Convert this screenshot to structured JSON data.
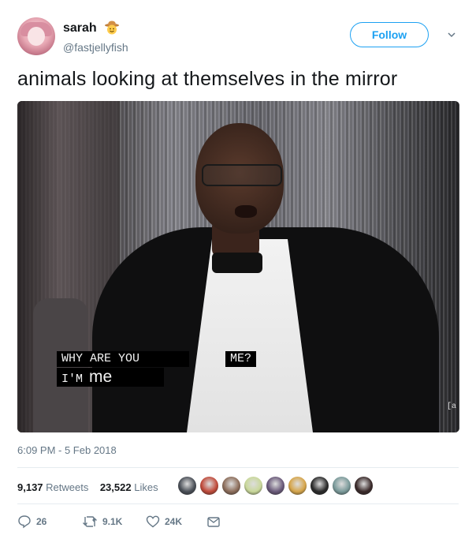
{
  "user": {
    "name": "sarah",
    "handle": "@fastjellyfish",
    "name_emoji": "cowboy-face-emoji",
    "follow_label": "Follow"
  },
  "tweet": {
    "text": "animals looking at themselves in the mirror",
    "timestamp": "6:09 PM - 5 Feb 2018"
  },
  "media": {
    "caption_line1": "WHY ARE YOU",
    "caption_line1_end": "ME?",
    "caption_line2_prefix": "I'M",
    "caption_line2_word": "me",
    "corner_mark": "[a"
  },
  "stats": {
    "retweets_count": "9,137",
    "retweets_label": "Retweets",
    "likes_count": "23,522",
    "likes_label": "Likes",
    "liker_colors": [
      "#4a4f57",
      "#c04a3a",
      "#8c6d5a",
      "#c9d89a",
      "#6a5a7a",
      "#d6a54a",
      "#2a2a2a",
      "#7a9a9a",
      "#3a2a2a"
    ]
  },
  "actions": {
    "replies": "26",
    "retweets": "9.1K",
    "likes": "24K"
  },
  "colors": {
    "accent": "#1da1f2",
    "secondary_text": "#657786",
    "divider": "#e6ecf0"
  }
}
